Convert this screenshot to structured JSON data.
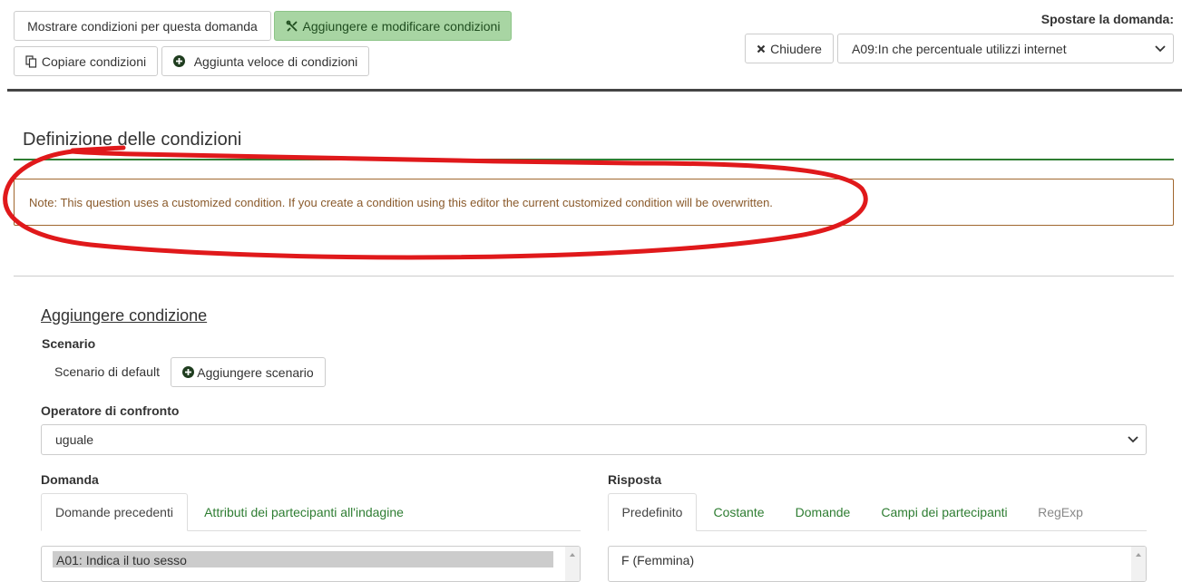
{
  "toolbar": {
    "show_conditions": "Mostrare condizioni per questa domanda",
    "add_edit_conditions": "Aggiungere e modificare condizioni",
    "copy_conditions": "Copiare condizioni",
    "quick_add": "Aggiunta veloce di condizioni",
    "move_question_label": "Spostare la domanda:",
    "close": "Chiudere",
    "question_select": "A09:In che percentuale utilizzi internet"
  },
  "definition": {
    "title": "Definizione delle condizioni",
    "note": "Note: This question uses a customized condition. If you create a condition using this editor the current customized condition will be overwritten."
  },
  "add_condition": {
    "title": "Aggiungere condizione",
    "scenario_label": "Scenario",
    "default_scenario": "Scenario di default",
    "add_scenario": "Aggiungere scenario",
    "operator_label": "Operatore di confronto",
    "operator_value": "uguale",
    "question_label": "Domanda",
    "question_tabs": [
      "Domande precedenti",
      "Attributi dei partecipanti all'indagine"
    ],
    "question_list_first": "A01: Indica il tuo sesso",
    "answer_label": "Risposta",
    "answer_tabs": [
      "Predefinito",
      "Costante",
      "Domande",
      "Campi dei partecipanti",
      "RegExp"
    ],
    "answer_list_first": "F (Femmina)"
  },
  "colors": {
    "accent_green": "#2e7d32",
    "active_button_bg": "#a8d5a3",
    "note_border": "#a0672e",
    "note_text": "#8a5a2b",
    "annotation_red": "#e0191b"
  }
}
